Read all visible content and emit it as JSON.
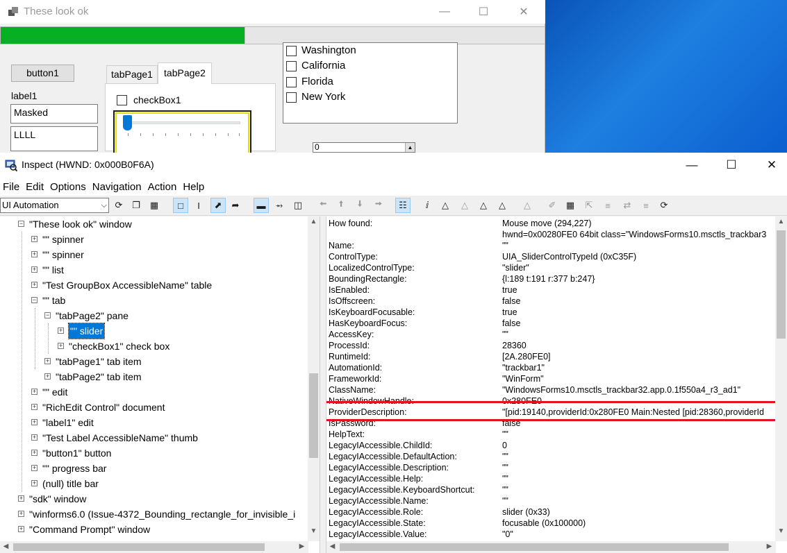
{
  "app_window": {
    "title": "These look ok",
    "button1": "button1",
    "label1": "label1",
    "masked_text": "Masked",
    "rich_text": "LLLL",
    "tabs": [
      "tabPage1",
      "tabPage2"
    ],
    "checkbox1": "checkBox1",
    "list_items": [
      "Washington",
      "California",
      "Florida",
      "New York"
    ],
    "spinner_value": "0",
    "progress_percent": 45
  },
  "inspect": {
    "title": "Inspect  (HWND: 0x000B0F6A)",
    "menu": [
      "File",
      "Edit",
      "Options",
      "Navigation",
      "Action",
      "Help"
    ],
    "mode": "UI Automation",
    "tree": [
      {
        "depth": 0,
        "label": "\"These look ok\" window"
      },
      {
        "depth": 1,
        "label": "\"\" spinner"
      },
      {
        "depth": 1,
        "label": "\"\" spinner"
      },
      {
        "depth": 1,
        "label": "\"\" list"
      },
      {
        "depth": 1,
        "label": "\"Test GroupBox AccessibleName\" table"
      },
      {
        "depth": 1,
        "label": "\"\" tab"
      },
      {
        "depth": 2,
        "label": "\"tabPage2\" pane"
      },
      {
        "depth": 3,
        "label": "\"\" slider",
        "selected": true
      },
      {
        "depth": 3,
        "label": "\"checkBox1\" check box"
      },
      {
        "depth": 2,
        "label": "\"tabPage1\" tab item"
      },
      {
        "depth": 2,
        "label": "\"tabPage2\" tab item"
      },
      {
        "depth": 1,
        "label": "\"\" edit"
      },
      {
        "depth": 1,
        "label": "\"RichEdit Control\" document"
      },
      {
        "depth": 1,
        "label": "\"label1\" edit"
      },
      {
        "depth": 1,
        "label": "\"Test Label AccessibleName\" thumb"
      },
      {
        "depth": 1,
        "label": "\"button1\" button"
      },
      {
        "depth": 1,
        "label": "\"\" progress bar"
      },
      {
        "depth": 1,
        "label": "(null) title bar"
      },
      {
        "depth": 0,
        "label": "\"sdk\" window"
      },
      {
        "depth": 0,
        "label": "\"winforms6.0 (Issue-4372_Bounding_rectangle_for_invisible_i"
      },
      {
        "depth": 0,
        "label": "\"Command Prompt\" window"
      }
    ],
    "properties": [
      {
        "name": "How found:",
        "value": "Mouse move (294,227)"
      },
      {
        "name": "",
        "value": "hwnd=0x00280FE0 64bit class=\"WindowsForms10.msctls_trackbar3"
      },
      {
        "name": "Name:",
        "value": "\"\""
      },
      {
        "name": "ControlType:",
        "value": "UIA_SliderControlTypeId (0xC35F)"
      },
      {
        "name": "LocalizedControlType:",
        "value": "\"slider\""
      },
      {
        "name": "BoundingRectangle:",
        "value": "{l:189 t:191 r:377 b:247}"
      },
      {
        "name": "IsEnabled:",
        "value": "true"
      },
      {
        "name": "IsOffscreen:",
        "value": "false"
      },
      {
        "name": "IsKeyboardFocusable:",
        "value": "true"
      },
      {
        "name": "HasKeyboardFocus:",
        "value": "false"
      },
      {
        "name": "AccessKey:",
        "value": "\"\""
      },
      {
        "name": "ProcessId:",
        "value": "28360"
      },
      {
        "name": "RuntimeId:",
        "value": "[2A.280FE0]"
      },
      {
        "name": "AutomationId:",
        "value": "\"trackbar1\""
      },
      {
        "name": "FrameworkId:",
        "value": "\"WinForm\""
      },
      {
        "name": "ClassName:",
        "value": "\"WindowsForms10.msctls_trackbar32.app.0.1f550a4_r3_ad1\""
      },
      {
        "name": "NativeWindowHandle:",
        "value": "0x280FE0"
      },
      {
        "name": "ProviderDescription:",
        "value": "\"[pid:19140,providerId:0x280FE0 Main:Nested [pid:28360,providerId"
      },
      {
        "name": "IsPassword:",
        "value": "false"
      },
      {
        "name": "HelpText:",
        "value": "\"\""
      },
      {
        "name": "LegacyIAccessible.ChildId:",
        "value": "0"
      },
      {
        "name": "LegacyIAccessible.DefaultAction:",
        "value": "\"\""
      },
      {
        "name": "LegacyIAccessible.Description:",
        "value": "\"\""
      },
      {
        "name": "LegacyIAccessible.Help:",
        "value": "\"\""
      },
      {
        "name": "LegacyIAccessible.KeyboardShortcut:",
        "value": "\"\""
      },
      {
        "name": "LegacyIAccessible.Name:",
        "value": "\"\""
      },
      {
        "name": "LegacyIAccessible.Role:",
        "value": "slider (0x33)"
      },
      {
        "name": "LegacyIAccessible.State:",
        "value": "focusable (0x100000)"
      },
      {
        "name": "LegacyIAccessible.Value:",
        "value": "\"0\""
      }
    ],
    "highlighted_property": "ProviderDescription:"
  }
}
